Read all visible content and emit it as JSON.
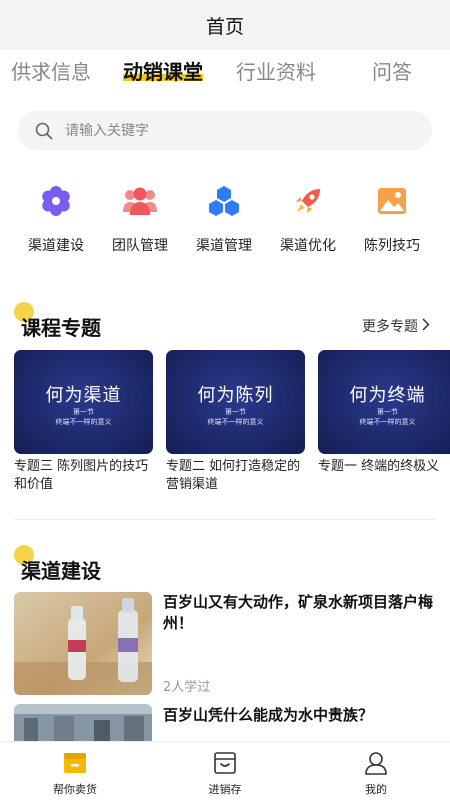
{
  "header": {
    "title": "首页"
  },
  "tabs": [
    {
      "label": "供求信息",
      "active": false
    },
    {
      "label": "动销课堂",
      "active": true
    },
    {
      "label": "行业资料",
      "active": false
    },
    {
      "label": "问答",
      "active": false
    }
  ],
  "search": {
    "placeholder": "请输入关键字",
    "value": ""
  },
  "categories": [
    {
      "label": "渠道建设",
      "icon": "flower-gear-icon",
      "color": "#7a5cf5"
    },
    {
      "label": "团队管理",
      "icon": "team-icon",
      "color": "#f0575b"
    },
    {
      "label": "渠道管理",
      "icon": "hexagon-cluster-icon",
      "color": "#2f7cf6"
    },
    {
      "label": "渠道优化",
      "icon": "rocket-icon",
      "color": "#f25a4a"
    },
    {
      "label": "陈列技巧",
      "icon": "image-icon",
      "color": "#f6a14a"
    }
  ],
  "topics_section": {
    "title": "课程专题",
    "more_label": "更多专题",
    "cards": [
      {
        "cover_title": "何为渠道",
        "cover_sub1": "第一节",
        "cover_sub2": "终端不一样的意义",
        "title": "专题三 陈列图片的技巧和价值"
      },
      {
        "cover_title": "何为陈列",
        "cover_sub1": "第一节",
        "cover_sub2": "终端不一样的意义",
        "title": "专题二 如何打造稳定的营销渠道"
      },
      {
        "cover_title": "何为终端",
        "cover_sub1": "第一节",
        "cover_sub2": "终端不一样的意义",
        "title": "专题一 终端的终极义"
      }
    ]
  },
  "channel_section": {
    "title": "渠道建设",
    "articles": [
      {
        "title": "百岁山又有大动作，矿泉水新项目落户梅州！",
        "meta": "2人学过"
      },
      {
        "title": "百岁山凭什么能成为水中贵族？",
        "meta": ""
      }
    ]
  },
  "bottom_nav": [
    {
      "label": "帮你卖货",
      "icon": "shop-box-icon",
      "active": true
    },
    {
      "label": "进销存",
      "icon": "inventory-icon",
      "active": false
    },
    {
      "label": "我的",
      "icon": "user-icon",
      "active": false
    }
  ],
  "colors": {
    "accent": "#f5c518",
    "card_blue": "#1e2a6d"
  }
}
